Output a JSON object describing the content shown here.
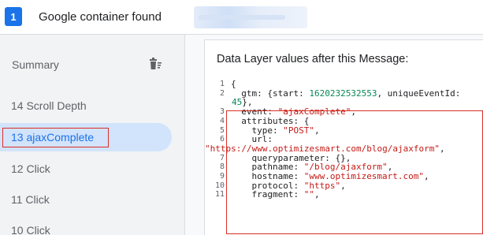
{
  "topbar": {
    "count_badge": "1",
    "container_found": "Google container found"
  },
  "sidebar": {
    "summary_label": "Summary",
    "items": [
      {
        "number": "14",
        "label": "Scroll Depth",
        "text": "14  Scroll Depth"
      },
      {
        "number": "13",
        "label": "ajaxComplete",
        "text": "13  ajaxComplete",
        "selected": true
      },
      {
        "number": "12",
        "label": "Click",
        "text": "12  Click"
      },
      {
        "number": "11",
        "label": "Click",
        "text": "11  Click"
      },
      {
        "number": "10",
        "label": "Click",
        "text": "10  Click"
      }
    ]
  },
  "main": {
    "card_title": "Data Layer values after this Message:",
    "code_lines": [
      {
        "n": "1",
        "parts": [
          {
            "t": "{",
            "c": ""
          }
        ]
      },
      {
        "n": "2",
        "parts": [
          {
            "t": "  gtm: {start: ",
            "c": ""
          },
          {
            "t": "1620232532553",
            "c": "num"
          },
          {
            "t": ", uniqueEventId:",
            "c": ""
          }
        ]
      },
      {
        "n": "",
        "parts": [
          {
            "t": "45",
            "c": "num"
          },
          {
            "t": "},",
            "c": ""
          }
        ],
        "wrap": true
      },
      {
        "n": "3",
        "parts": [
          {
            "t": "  event: ",
            "c": ""
          },
          {
            "t": "\"ajaxComplete\"",
            "c": "str"
          },
          {
            "t": ",",
            "c": ""
          }
        ]
      },
      {
        "n": "4",
        "parts": [
          {
            "t": "  attributes: {",
            "c": ""
          }
        ]
      },
      {
        "n": "5",
        "parts": [
          {
            "t": "    type: ",
            "c": ""
          },
          {
            "t": "\"POST\"",
            "c": "str"
          },
          {
            "t": ",",
            "c": ""
          }
        ]
      },
      {
        "n": "6",
        "parts": [
          {
            "t": "    url:",
            "c": ""
          }
        ]
      },
      {
        "n": "",
        "parts": [
          {
            "t": "\"https://www.optimizesmart.com/blog/ajaxform\"",
            "c": "str"
          },
          {
            "t": ",",
            "c": ""
          }
        ],
        "overflow": true
      },
      {
        "n": "7",
        "parts": [
          {
            "t": "    queryparameter: {},",
            "c": ""
          }
        ]
      },
      {
        "n": "8",
        "parts": [
          {
            "t": "    pathname: ",
            "c": ""
          },
          {
            "t": "\"/blog/ajaxform\"",
            "c": "str"
          },
          {
            "t": ",",
            "c": ""
          }
        ]
      },
      {
        "n": "9",
        "parts": [
          {
            "t": "    hostname: ",
            "c": ""
          },
          {
            "t": "\"www.optimizesmart.com\"",
            "c": "str"
          },
          {
            "t": ",",
            "c": ""
          }
        ]
      },
      {
        "n": "10",
        "parts": [
          {
            "t": "    protocol: ",
            "c": ""
          },
          {
            "t": "\"https\"",
            "c": "str"
          },
          {
            "t": ",",
            "c": ""
          }
        ]
      },
      {
        "n": "11",
        "parts": [
          {
            "t": "    fragment: ",
            "c": ""
          },
          {
            "t": "\"\"",
            "c": "str"
          },
          {
            "t": ",",
            "c": ""
          }
        ]
      }
    ]
  },
  "icons": {
    "delete": "clear-messages-icon"
  },
  "colors": {
    "accent": "#1a73e8",
    "selected_bg": "#d2e3fc",
    "highlight_box": "#d93025",
    "string": "#c41a16",
    "number": "#098658"
  }
}
